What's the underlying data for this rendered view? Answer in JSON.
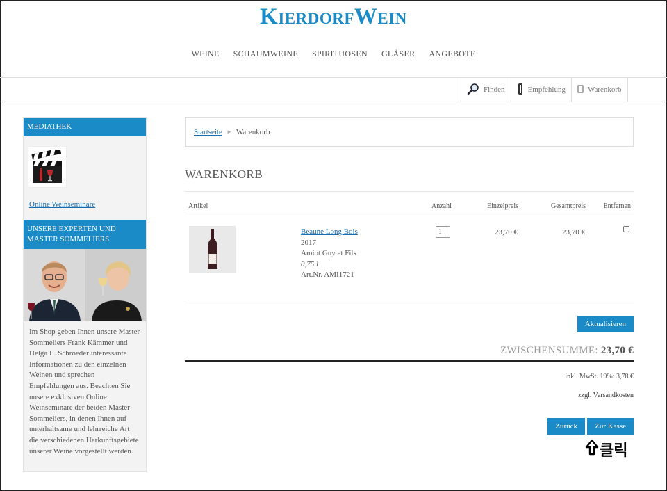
{
  "header": {
    "logo_first": "Kierdorf",
    "logo_second": "Wein",
    "nav": [
      "WEINE",
      "SCHAUMWEINE",
      "SPIRITUOSEN",
      "GLÄSER",
      "ANGEBOTE"
    ]
  },
  "utility": {
    "find": "Finden",
    "recommend": "Empfehlung",
    "cart": "Warenkorb"
  },
  "sidebar": {
    "media_title": "MEDIATHEK",
    "media_link": "Online Weinseminare",
    "experts_title": "UNSERE EXPERTEN UND MASTER SOMMELIERS",
    "experts_text": "Im Shop geben Ihnen unsere Master Sommeliers Frank Kämmer und Helga L. Schroeder interessante Informationen zu den einzelnen Weinen und sprechen Empfehlungen aus. Beachten Sie unsere exklusiven Online Weinseminare der beiden Master Sommeliers, in denen Ihnen auf unterhaltsame und lehrreiche Art die verschiedenen Herkunftsgebiete unserer Weine vorgestellt werden."
  },
  "breadcrumb": {
    "home": "Startseite",
    "separator": "►",
    "current": "Warenkorb"
  },
  "page_title": "WARENKORB",
  "table": {
    "headers": {
      "article": "Artikel",
      "quantity": "Anzahl",
      "unit_price": "Einzelpreis",
      "total_price": "Gesamtpreis",
      "remove": "Entfernen"
    },
    "items": [
      {
        "name": "Beaune Long Bois",
        "year": "2017",
        "producer": "Amiot Guy et Fils",
        "volume": "0,75 l",
        "article_no": "Art.Nr. AMI1721",
        "quantity": "1",
        "unit_price": "23,70 €",
        "total_price": "23,70 €",
        "remove_checked": false
      }
    ]
  },
  "buttons": {
    "update": "Aktualisieren",
    "back": "Zurück",
    "checkout": "Zur Kasse"
  },
  "summary": {
    "subtotal_label": "ZWISCHENSUMME:",
    "subtotal_value": "23,70 €",
    "tax": "inkl. MwSt. 19%: 3,78 €",
    "shipping": "zzgl. Versandkosten"
  },
  "annotation": {
    "text": "클릭"
  },
  "colors": {
    "accent": "#1a8bc7",
    "link": "#1a6fb0"
  }
}
